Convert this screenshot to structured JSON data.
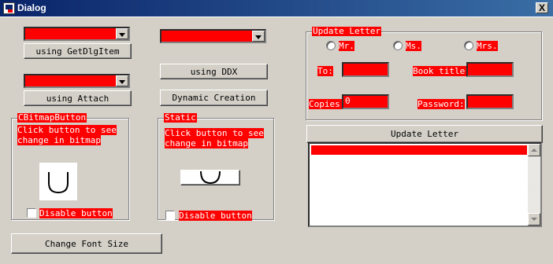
{
  "window": {
    "title": "Dialog",
    "close_label": "X"
  },
  "left_column": {
    "btn_getdlgitem": "using GetDlgItem",
    "btn_attach": "using Attach",
    "bitmap_group": {
      "legend": "CBitmapButton",
      "hint_line1": "Click button to see",
      "hint_line2": "change in bitmap",
      "disable_label": "Disable button"
    },
    "btn_font": "Change Font Size"
  },
  "middle_column": {
    "btn_ddx": "using DDX",
    "btn_dynamic": "Dynamic Creation",
    "static_group": {
      "legend": "Static",
      "hint_line1": "Click button to see",
      "hint_line2": "change in bitmap",
      "disable_label": "Disable button"
    }
  },
  "update_letter": {
    "legend": "Update Letter",
    "radio_mr": "Mr.",
    "radio_ms": "Ms.",
    "radio_mrs": "Mrs.",
    "to_label": "To:",
    "book_title_label": "Book title:",
    "copies_label": "Copies:",
    "copies_value": "0",
    "password_label": "Password:",
    "btn_update": "Update Letter"
  },
  "colors": {
    "highlight": "#ff0000",
    "face": "#d4d0c8",
    "titlebar": "#0a246a"
  }
}
